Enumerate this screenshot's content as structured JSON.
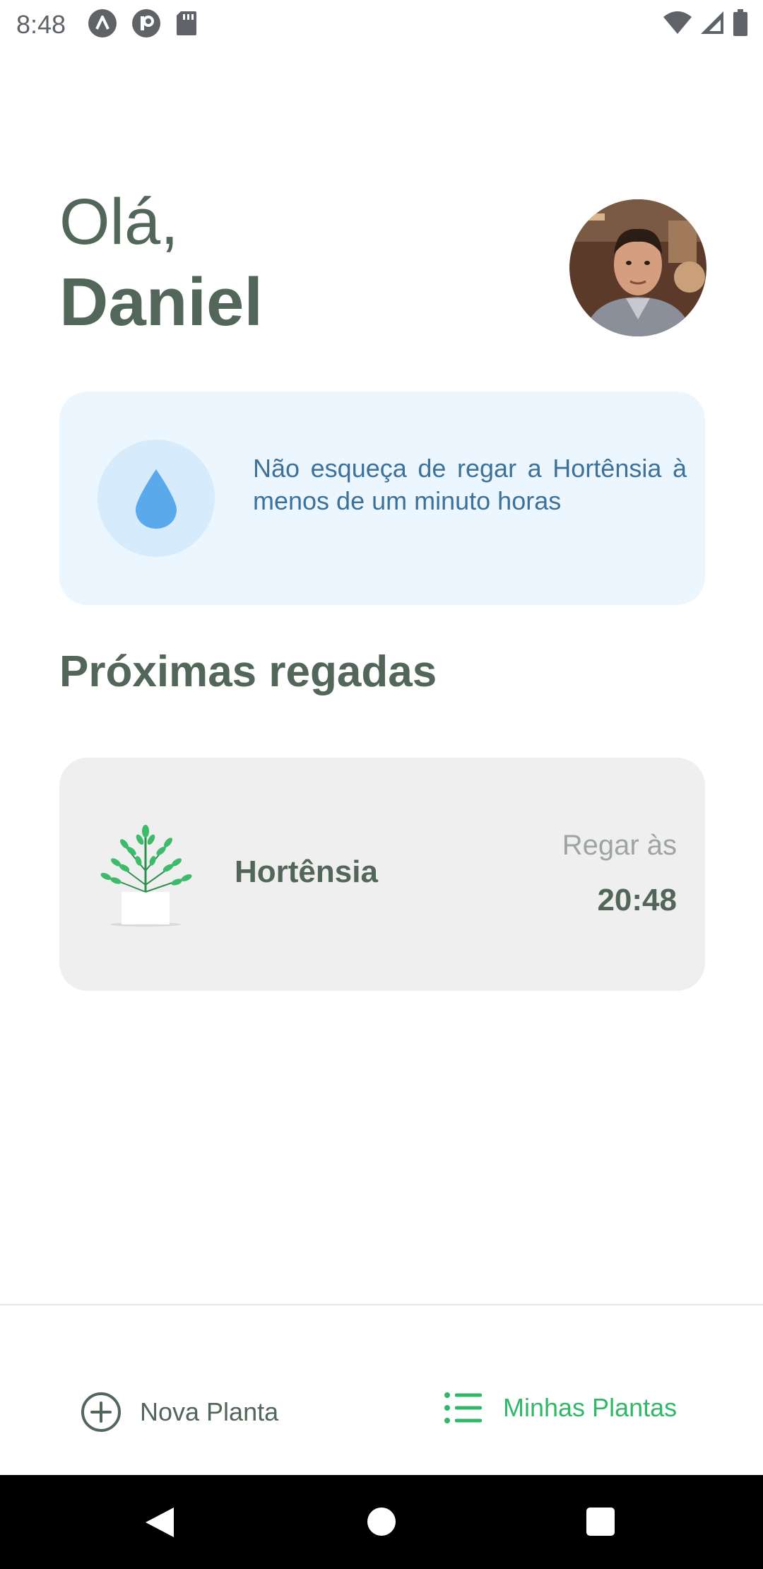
{
  "status_bar": {
    "time": "8:48",
    "icons": [
      "a-icon",
      "p-icon",
      "sd-card-icon",
      "wifi-icon",
      "signal-icon",
      "battery-icon"
    ]
  },
  "greeting": {
    "hello": "Olá,",
    "name": "Daniel"
  },
  "reminder": {
    "icon": "water-drop-icon",
    "text": "Não esqueça de regar a Hortênsia à menos de um minuto horas"
  },
  "section": {
    "title": "Próximas regadas"
  },
  "plants": [
    {
      "name": "Hortênsia",
      "water_at_label": "Regar às",
      "water_at_time": "20:48"
    }
  ],
  "tabs": {
    "new_plant": {
      "label": "Nova Planta",
      "icon": "add-circle-icon"
    },
    "my_plants": {
      "label": "Minhas Plantas",
      "icon": "list-icon",
      "active": true
    }
  },
  "colors": {
    "heading": "#52665a",
    "accent_green": "#32b768",
    "reminder_bg": "#ebf6ff",
    "reminder_text": "#3d7199",
    "card_bg": "#efefef"
  }
}
